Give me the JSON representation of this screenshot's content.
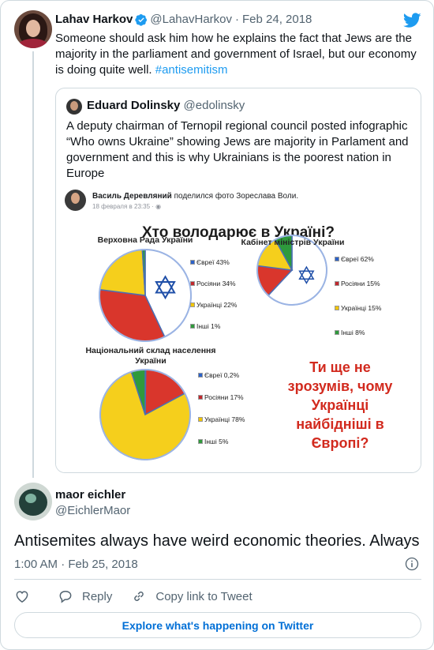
{
  "parent_tweet": {
    "author_name": "Lahav Harkov",
    "author_handle": "@LahavHarkov",
    "separator": "·",
    "date": "Feb 24, 2018",
    "text": "Someone should ask him how he explains the fact that Jews are the majority in the parliament and government of Israel, but our economy is doing quite well. ",
    "hashtag": "#antisemitism",
    "verified_icon": "verified-badge-icon",
    "brand_icon": "twitter-bird-icon",
    "brand_color": "#1d9bf0"
  },
  "quoted_tweet": {
    "author_name": "Eduard Dolinsky",
    "author_handle": "@edolinsky",
    "text": "A deputy chairman of Ternopil regional council posted infographic “Who owns Ukraine” showing Jews are majority in Parlament and government and this is why Ukrainians is the poorest nation in Europe"
  },
  "infographic": {
    "post_author": "Василь Деревляний",
    "post_action": "поделился фото Зореслава Воли.",
    "post_date": "18 февраля в 23:35 · ",
    "title": "Хто володарює в  Україні?",
    "closing_text_lines": [
      "Ти ще не",
      "зрозумів, чому",
      "Українці",
      "найбідніші в",
      "Європі?"
    ]
  },
  "chart_data": [
    {
      "type": "pie",
      "title": "Верховна Рада України",
      "categories": [
        "Євреї",
        "Росіяни",
        "Українці",
        "Інші"
      ],
      "values": [
        43,
        34,
        22,
        1
      ],
      "labels": [
        "Євреї 43%",
        "Росіяни 34%",
        "Українці 22%",
        "Інші 1%"
      ]
    },
    {
      "type": "pie",
      "title": "Кабінет міністрів України",
      "categories": [
        "Євреї",
        "Росіяни",
        "Українці",
        "Інші"
      ],
      "values": [
        62,
        15,
        15,
        8
      ],
      "labels": [
        "Євреї 62%",
        "Росіяни 15%",
        "Українці 15%",
        "Інші 8%"
      ]
    },
    {
      "type": "pie",
      "title": "Національний склад населення України",
      "categories": [
        "Євреї",
        "Росіяни",
        "Українці",
        "Інші"
      ],
      "values": [
        0.2,
        17,
        78,
        5
      ],
      "labels": [
        "Євреї 0,2%",
        "Росіяни 17%",
        "Українці 78%",
        "Інші 5%"
      ]
    }
  ],
  "reply_tweet": {
    "author_name": "maor eichler",
    "author_handle": "@EichlerMaor",
    "text": "Antisemites always have weird economic theories. Always",
    "timestamp": "1:00 AM · Feb 25, 2018"
  },
  "actions": {
    "reply_label": "Reply",
    "copy_link_label": "Copy link to Tweet",
    "like_icon": "heart-icon",
    "reply_icon": "speech-bubble-icon",
    "link_icon": "chain-link-icon"
  },
  "footer": {
    "explore_label": "Explore what's happening on Twitter"
  }
}
